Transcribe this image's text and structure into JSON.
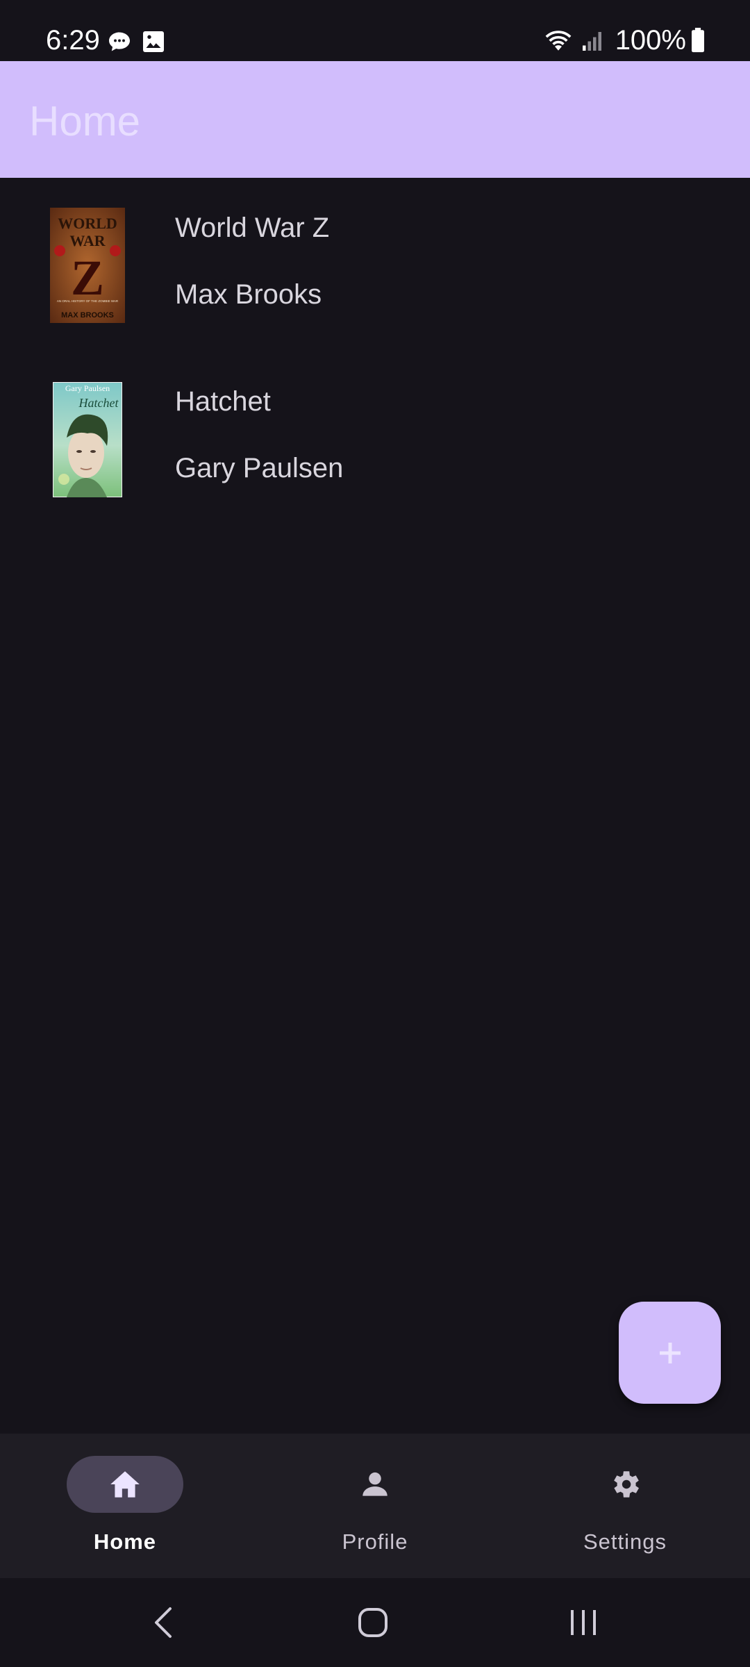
{
  "status_bar": {
    "time": "6:29",
    "battery": "100%",
    "icons": [
      "chat-bubble-icon",
      "image-icon",
      "wifi-icon",
      "signal-icon",
      "battery-icon"
    ]
  },
  "app_bar": {
    "title": "Home"
  },
  "books": [
    {
      "title": "World War Z",
      "author": "Max Brooks"
    },
    {
      "title": "Hatchet",
      "author": "Gary Paulsen"
    }
  ],
  "cover_art": {
    "world_war_z": {
      "lines": [
        "WORLD",
        "WAR",
        "Z"
      ],
      "byline": "MAX BROOKS",
      "tagline": "AN ORAL HISTORY OF THE ZOMBIE WAR"
    },
    "hatchet": {
      "author": "Gary Paulsen",
      "title": "Hatchet"
    }
  },
  "fab": {
    "icon": "plus-icon"
  },
  "bottom_nav": {
    "items": [
      {
        "label": "Home",
        "icon": "home-icon",
        "active": true
      },
      {
        "label": "Profile",
        "icon": "person-icon",
        "active": false
      },
      {
        "label": "Settings",
        "icon": "gear-icon",
        "active": false
      }
    ]
  },
  "system_nav": {
    "icons": [
      "back-icon",
      "home-circle-icon",
      "recents-icon"
    ]
  },
  "colors": {
    "background": "#15131a",
    "accent": "#d1bdfc",
    "nav_background": "#1f1d24",
    "active_pill": "#4a4458",
    "text": "#d9d6de"
  }
}
